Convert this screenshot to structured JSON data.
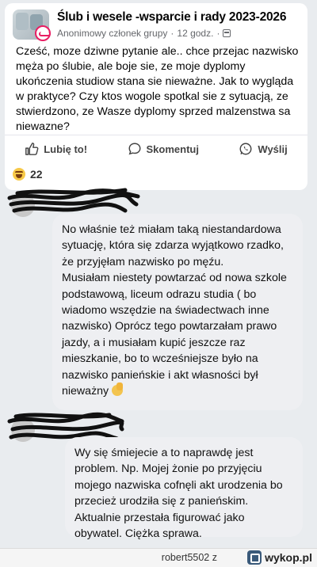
{
  "post": {
    "group_title": "Ślub i wesele -wsparcie i rady 2023-2026",
    "author": "Anonimowy członek grupy",
    "time": "12 godz.",
    "text": "Cześć, moze dziwne pytanie ale.. chce przejac nazwisko męża po ślubie, ale boje sie, ze moje dyplomy ukończenia studiow stana sie nieważne. Jak to wygląda w praktyce? Czy ktos wogole spotkal sie z sytuacją, ze stwierdzono, ze Wasze dyplomy sprzed malzenstwa sa niewazne?",
    "actions": {
      "like": "Lubię to!",
      "comment": "Skomentuj",
      "share": "Wyślij"
    },
    "reaction_count": "22",
    "reaction_icon": "haha-emoji-icon"
  },
  "comments": [
    {
      "paragraphs": [
        "No właśnie też miałam taką niestandardowa sytuację, która się zdarza wyjątkowo rzadko, że przyjęłam nazwisko po męźu.",
        "Musiałam niestety powtarzać od nowa szkole podstawową, liceum odrazu studia ( bo wiadomo wszędzie na świadectwach inne nazwisko) Oprócz tego powtarzałam prawo jazdy, a i musiałam kupić jeszcze raz mieszkanie, bo to wcześniejsze było na nazwisko panieńskie i akt własności był nieważny"
      ],
      "emoji_icon": "face-palm-emoji-icon"
    },
    {
      "paragraphs": [
        "Wy się śmiejecie a to naprawdę jest problem. Np. Mojej żonie po przyjęciu mojego nazwiska cofnęli akt urodzenia bo przecież urodziła się z panieńskim. Aktualnie przestała figurować jako obywatel. Ciężka sprawa."
      ]
    }
  ],
  "footer": {
    "user": "robert5502",
    "separator": "z",
    "site": "wykop.pl"
  },
  "colors": {
    "background": "#e9ecef",
    "bubble": "#eeeff2",
    "meta_text": "#65676b",
    "anon_badge": "#e91e63"
  }
}
